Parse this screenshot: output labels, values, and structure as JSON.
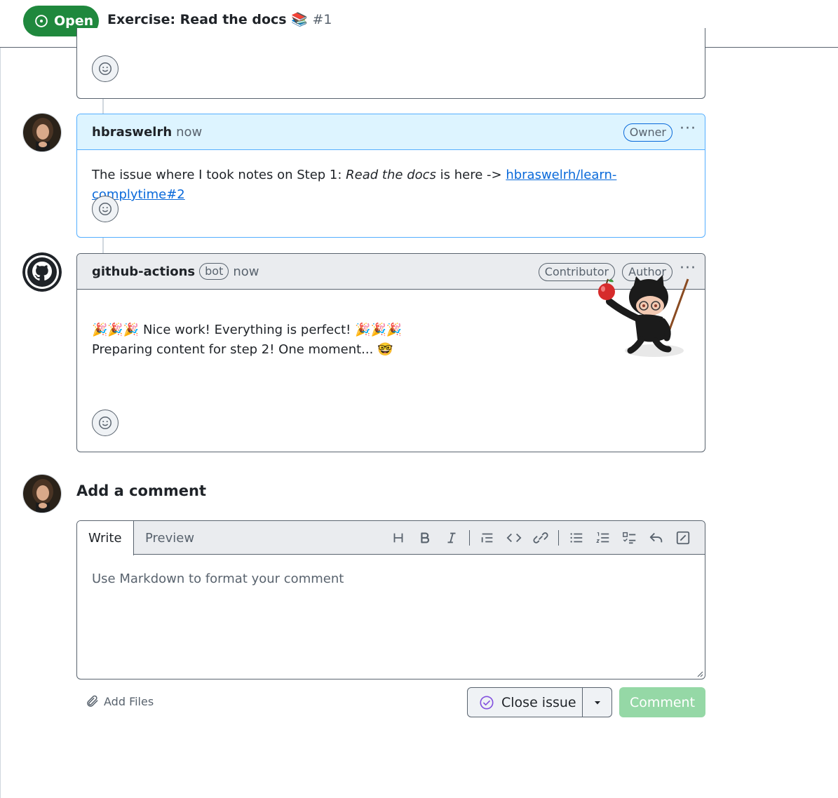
{
  "header": {
    "state_label": "Open",
    "title": "Exercise: Read the docs 📚",
    "number": "#1"
  },
  "comments": [
    {
      "author": "hbraswelrh",
      "time": "now",
      "roles": [
        "Owner"
      ],
      "body_prefix": "The issue where I took notes on Step 1: ",
      "body_emphasis": "Read the docs",
      "body_middle": " is here -> ",
      "body_link": "hbraswelrh/learn-complytime#2"
    },
    {
      "author": "github-actions",
      "bot_label": "bot",
      "time": "now",
      "roles": [
        "Contributor",
        "Author"
      ],
      "line1": "🎉🎉🎉 Nice work! Everything is perfect! 🎉🎉🎉",
      "line2": "Preparing content for step 2! One moment... 🤓"
    }
  ],
  "composer": {
    "title": "Add a comment",
    "tab_write": "Write",
    "tab_preview": "Preview",
    "placeholder": "Use Markdown to format your comment",
    "add_files": "Add Files",
    "close_issue": "Close issue",
    "comment_button": "Comment"
  },
  "colors": {
    "open_green": "#1f883d",
    "owner_header_bg": "#ddf4ff",
    "link": "#0969da",
    "comment_button_disabled": "#95d8a6"
  }
}
